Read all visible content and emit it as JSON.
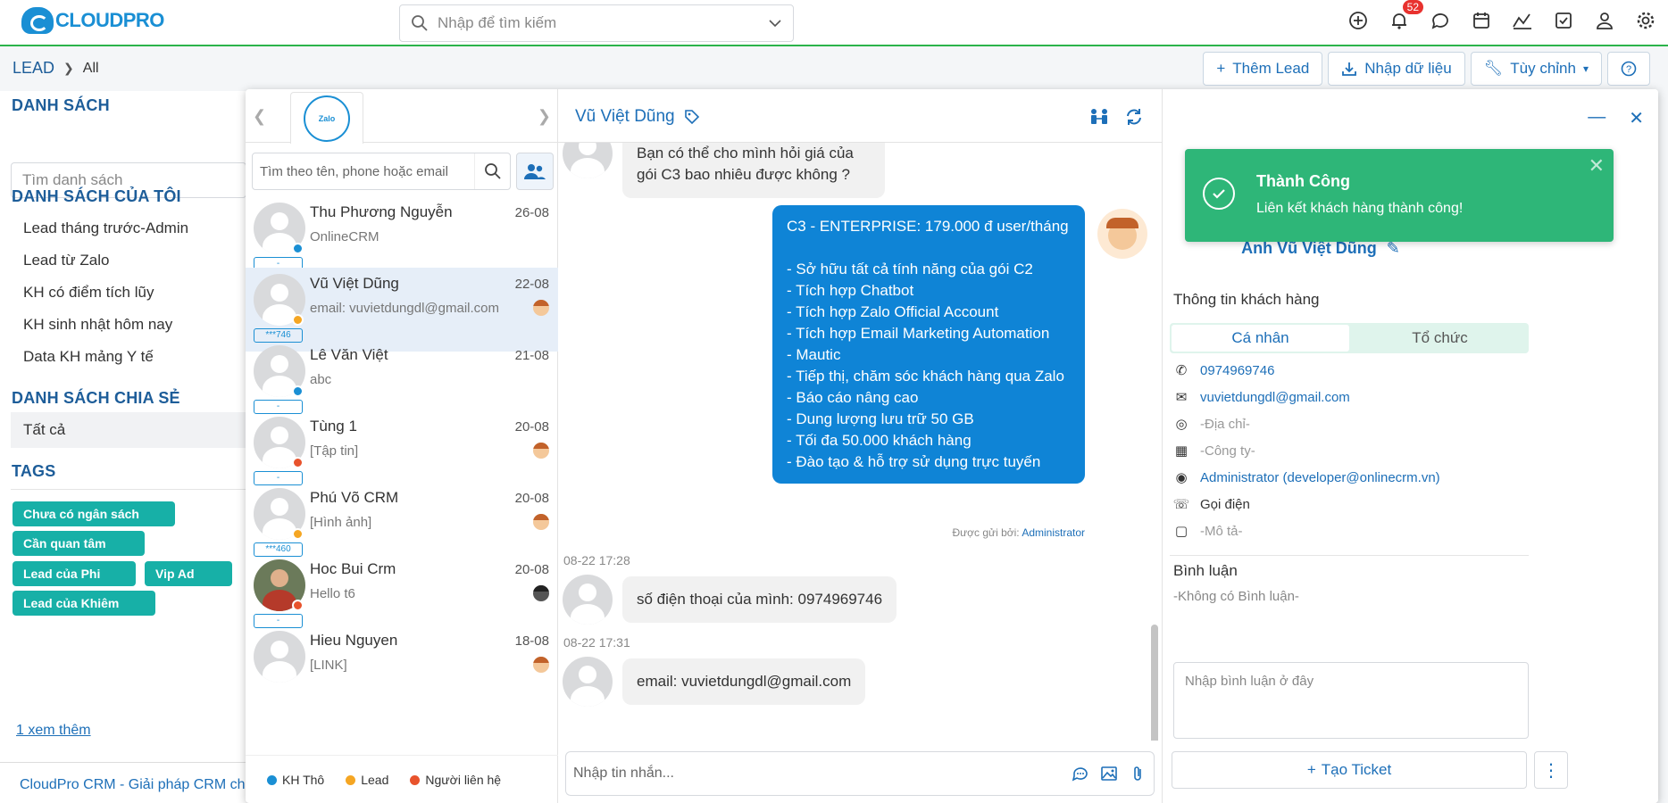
{
  "app": {
    "logo_text": "CLOUDPRO",
    "logo_tagline": "",
    "search_placeholder": "Nhập để tìm kiếm",
    "notification_count": "52"
  },
  "breadcrumb": {
    "module": "LEAD",
    "current": "All"
  },
  "actions": {
    "add_lead": "Thêm Lead",
    "import": "Nhập dữ liệu",
    "customize": "Tùy chỉnh"
  },
  "sidebar": {
    "list_title": "DANH SÁCH",
    "search_placeholder": "Tìm danh sách",
    "my_lists_title": "DANH SÁCH CỦA TÔI",
    "my_lists": [
      "Lead tháng trước-Admin",
      "Lead từ Zalo",
      "KH có điểm tích lũy",
      "KH sinh nhật hôm nay",
      "Data KH mảng Y tế"
    ],
    "shared_title": "DANH SÁCH CHIA SẺ",
    "shared_lists": [
      "Tất cả"
    ],
    "tags_title": "TAGS",
    "tags": [
      "Chưa có ngân sách",
      "Cần quan tâm",
      "Lead của Phi",
      "Vip Ad",
      "Lead của Khiêm"
    ],
    "more_link": "1  xem thêm",
    "footer": "CloudPro CRM - Giải pháp CRM chuyên nghiệp"
  },
  "conversations": {
    "oa_label": "Zalo",
    "search_placeholder": "Tìm theo tên, phone hoặc email",
    "items": [
      {
        "name": "Thu Phương Nguyễn",
        "date": "26-08",
        "preview": "OnlineCRM",
        "phone": "-",
        "status_color": "#1a8fd4"
      },
      {
        "name": "Vũ Việt Dũng",
        "date": "22-08",
        "preview": "email: vuvietdungdl@gmail.com",
        "phone": "***746",
        "status_color": "#f5a623"
      },
      {
        "name": "Lê Văn Việt",
        "date": "21-08",
        "preview": "abc",
        "phone": "-",
        "status_color": "#1a8fd4"
      },
      {
        "name": "Tùng 1",
        "date": "20-08",
        "preview": "[Tập tin]",
        "phone": "-",
        "status_color": "#e8532c"
      },
      {
        "name": "Phú Võ CRM",
        "date": "20-08",
        "preview": "[Hình ảnh]",
        "phone": "***460",
        "status_color": "#f5a623"
      },
      {
        "name": "Hoc Bui Crm",
        "date": "20-08",
        "preview": "Hello t6",
        "phone": "-",
        "status_color": "#e8532c"
      },
      {
        "name": "Hieu Nguyen",
        "date": "18-08",
        "preview": "[LINK]",
        "phone": "-",
        "status_color": "#1a8fd4"
      }
    ],
    "legend": [
      {
        "label": "KH Thô",
        "color": "#1a8fd4"
      },
      {
        "label": "Lead",
        "color": "#f5a623"
      },
      {
        "label": "Người liên hệ",
        "color": "#e8532c"
      }
    ]
  },
  "chat": {
    "title": "Vũ Việt Dũng",
    "msg_top": "Bạn có thể cho mình hỏi giá của gói C3 bao nhiêu được không ?",
    "msg_out": "C3 - ENTERPRISE: 179.000 đ user/tháng\n\n- Sở hữu tất cả tính năng của gói C2\n- Tích hợp Chatbot\n- Tích hợp Zalo Official Account\n- Tích hợp Email Marketing Automation\n- Mautic\n- Tiếp thị, chăm sóc khách hàng qua Zalo\n- Báo cáo nâng cao\n- Dung lượng lưu trữ 50 GB\n- Tối đa 50.000 khách hàng\n- Đào tạo & hỗ trợ sử dụng trực tuyến",
    "sent_by_label": "Được gửi bởi:",
    "sent_by": "Administrator",
    "ts1": "08-22 17:28",
    "msg_phone": "số điện thoại của mình: 0974969746",
    "ts2": "08-22 17:31",
    "msg_email": "email: vuvietdungdl@gmail.com",
    "input_placeholder": "Nhập tin nhắn..."
  },
  "customer": {
    "display_name": "Anh Vũ Việt Dũng",
    "section_title": "Thông tin khách hàng",
    "tab_personal": "Cá nhân",
    "tab_org": "Tổ chức",
    "phone": "0974969746",
    "email": "vuvietdungdl@gmail.com",
    "address": "-Địa chỉ-",
    "company": "-Công ty-",
    "owner": "Administrator (developer@onlinecrm.vn)",
    "call": "Gọi điện",
    "description": "-Mô tả-",
    "comments_title": "Bình luận",
    "no_comments": "-Không có Bình luận-",
    "comment_placeholder": "Nhập bình luận ở đây",
    "ticket_button": "Tạo Ticket"
  },
  "toast": {
    "title": "Thành Công",
    "message": "Liên kết khách hàng thành công!"
  }
}
